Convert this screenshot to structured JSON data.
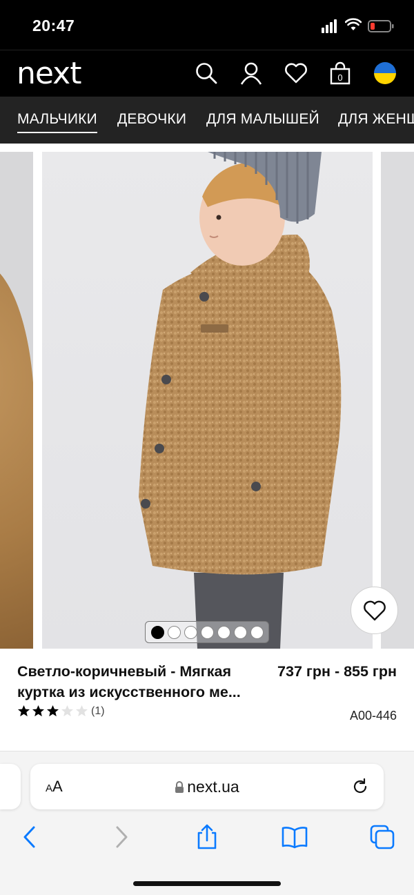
{
  "status_bar": {
    "time": "20:47"
  },
  "header": {
    "logo": "next",
    "bag_count": "0"
  },
  "nav": {
    "items": [
      "МАЛЬЧИКИ",
      "ДЕВОЧКИ",
      "ДЛЯ МАЛЫШЕЙ",
      "ДЛЯ ЖЕНЩИН"
    ]
  },
  "product": {
    "title": "Светло-коричневый - Мягкая куртка из искусственного ме...",
    "price": "737 грн - 855 грн",
    "rating_stars": 3,
    "rating_max": 5,
    "rating_count": "(1)",
    "sku": "A00-446",
    "gallery_images": 7,
    "gallery_active": 1
  },
  "browser": {
    "text_size_label": "AA",
    "url": "next.ua"
  },
  "colors": {
    "header_bg": "#000000",
    "nav_bg": "#232323",
    "browser_accent": "#0a7aff",
    "flag_blue": "#1f6fd6",
    "flag_yellow": "#ffd400"
  }
}
